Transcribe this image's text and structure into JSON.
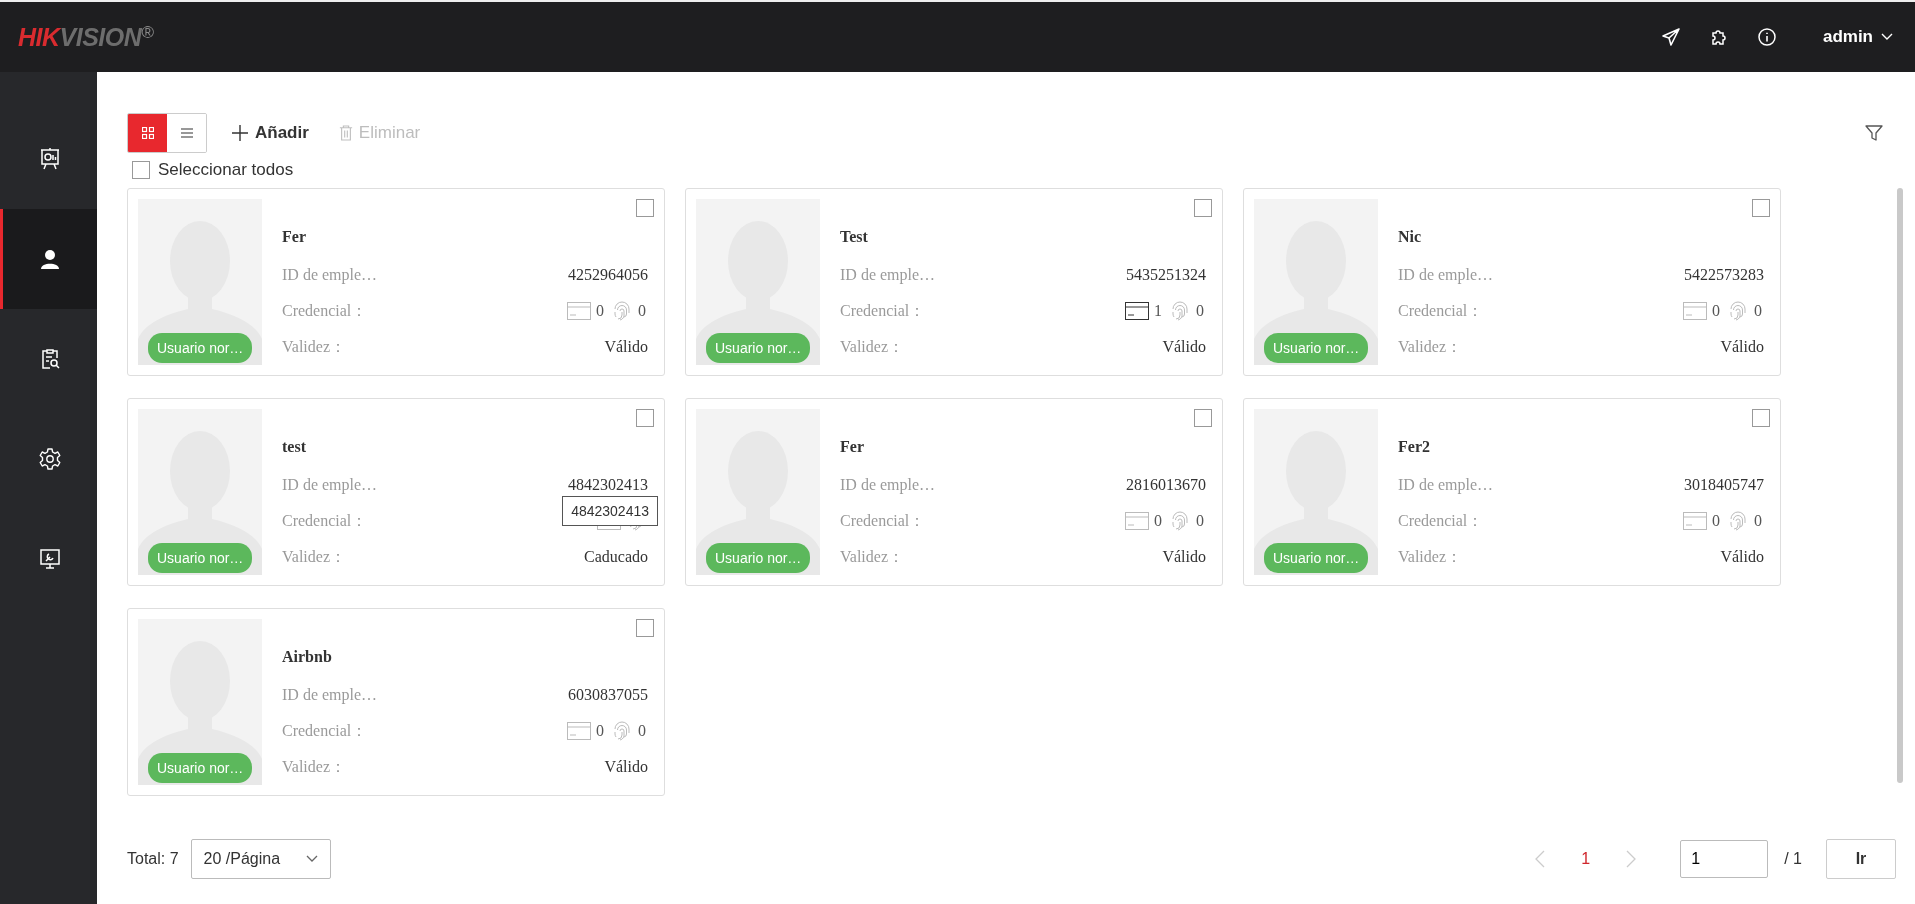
{
  "header": {
    "logo_red": "HIK",
    "logo_gray": "VISION",
    "logo_mark": "®",
    "user": "admin"
  },
  "sidebar": {
    "items": [
      {
        "selected": false
      },
      {
        "selected": true
      },
      {
        "selected": false
      },
      {
        "selected": false
      },
      {
        "selected": false
      }
    ]
  },
  "toolbar": {
    "views": [
      {
        "selected": true
      },
      {
        "selected": false
      }
    ],
    "add": "Añadir",
    "delete": {
      "label": "Eliminar",
      "disabled": true
    },
    "select_all": {
      "label": "Seleccionar todos",
      "checked": false
    }
  },
  "people": [
    {
      "name": "Fer",
      "badge": "Usuario nor…",
      "id_label": "ID de emple…",
      "id": "4252964056",
      "credential_label": "Credencial：",
      "card_active": false,
      "card_count": "0",
      "fingerprint_count": "0",
      "validity_label": "Validez：",
      "validity": "Válido",
      "checked": false
    },
    {
      "name": "Test",
      "badge": "Usuario nor…",
      "id_label": "ID de emple…",
      "id": "5435251324",
      "credential_label": "Credencial：",
      "card_active": true,
      "card_count": "1",
      "fingerprint_count": "0",
      "validity_label": "Validez：",
      "validity": "Válido",
      "checked": false
    },
    {
      "name": "Nic",
      "badge": "Usuario nor…",
      "id_label": "ID de emple…",
      "id": "5422573283",
      "credential_label": "Credencial：",
      "card_active": false,
      "card_count": "0",
      "fingerprint_count": "0",
      "validity_label": "Validez：",
      "validity": "Válido",
      "checked": false
    },
    {
      "name": "test",
      "badge": "Usuario nor…",
      "id_label": "ID de emple…",
      "id": "4842302413",
      "credential_label": "Credencial：",
      "card_active": false,
      "tooltip": "4842302413",
      "validity_label": "Validez：",
      "validity": "Caducado",
      "checked": false
    },
    {
      "name": "Fer",
      "badge": "Usuario nor…",
      "id_label": "ID de emple…",
      "id": "2816013670",
      "credential_label": "Credencial：",
      "card_active": false,
      "card_count": "0",
      "fingerprint_count": "0",
      "validity_label": "Validez：",
      "validity": "Válido",
      "checked": false
    },
    {
      "name": "Fer2",
      "badge": "Usuario nor…",
      "id_label": "ID de emple…",
      "id": "3018405747",
      "credential_label": "Credencial：",
      "card_active": false,
      "card_count": "0",
      "fingerprint_count": "0",
      "validity_label": "Validez：",
      "validity": "Válido",
      "checked": false
    },
    {
      "name": "Airbnb",
      "badge": "Usuario nor…",
      "id_label": "ID de emple…",
      "id": "6030837055",
      "credential_label": "Credencial：",
      "card_active": false,
      "card_count": "0",
      "fingerprint_count": "0",
      "validity_label": "Validez：",
      "validity": "Válido",
      "checked": false
    }
  ],
  "pagination": {
    "total": "Total: 7",
    "page_size": "20 /Página",
    "pages": [
      {
        "label": "1",
        "selected": true
      }
    ],
    "jump_value": "1",
    "page_count": "/ 1",
    "go": "Ir"
  }
}
